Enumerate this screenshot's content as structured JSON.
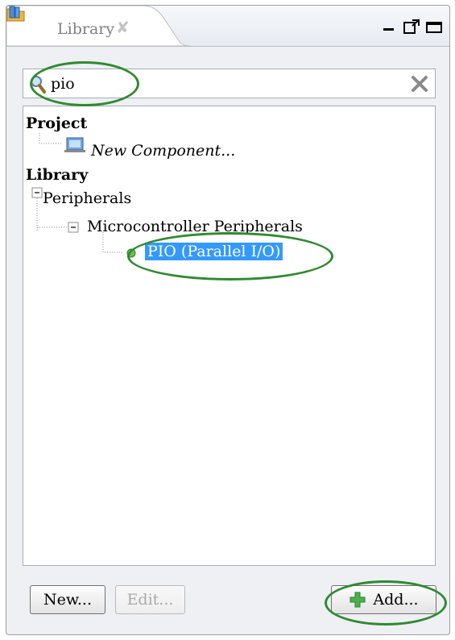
{
  "tab": {
    "title": "Library",
    "close_glyph": "✘",
    "icon": "library-folder-icon"
  },
  "window_controls": {
    "minimize": "minimize-icon",
    "restore": "restore-icon",
    "maximize": "maximize-icon"
  },
  "search": {
    "value": "pio",
    "icon": "search-icon",
    "clear_icon": "clear-icon"
  },
  "tree": {
    "project_header": "Project",
    "project_items": [
      {
        "label": "New Component...",
        "icon": "component-icon"
      }
    ],
    "library_header": "Library",
    "peripherals": "Peripherals",
    "micro": "Microcontroller Peripherals",
    "selected_item": "PIO (Parallel I/O)"
  },
  "buttons": {
    "new": "New...",
    "edit": "Edit...",
    "add": "Add..."
  },
  "colors": {
    "selection": "#3399ff",
    "highlight_ring": "#2f8a2f",
    "add_icon": "#4caf50"
  }
}
